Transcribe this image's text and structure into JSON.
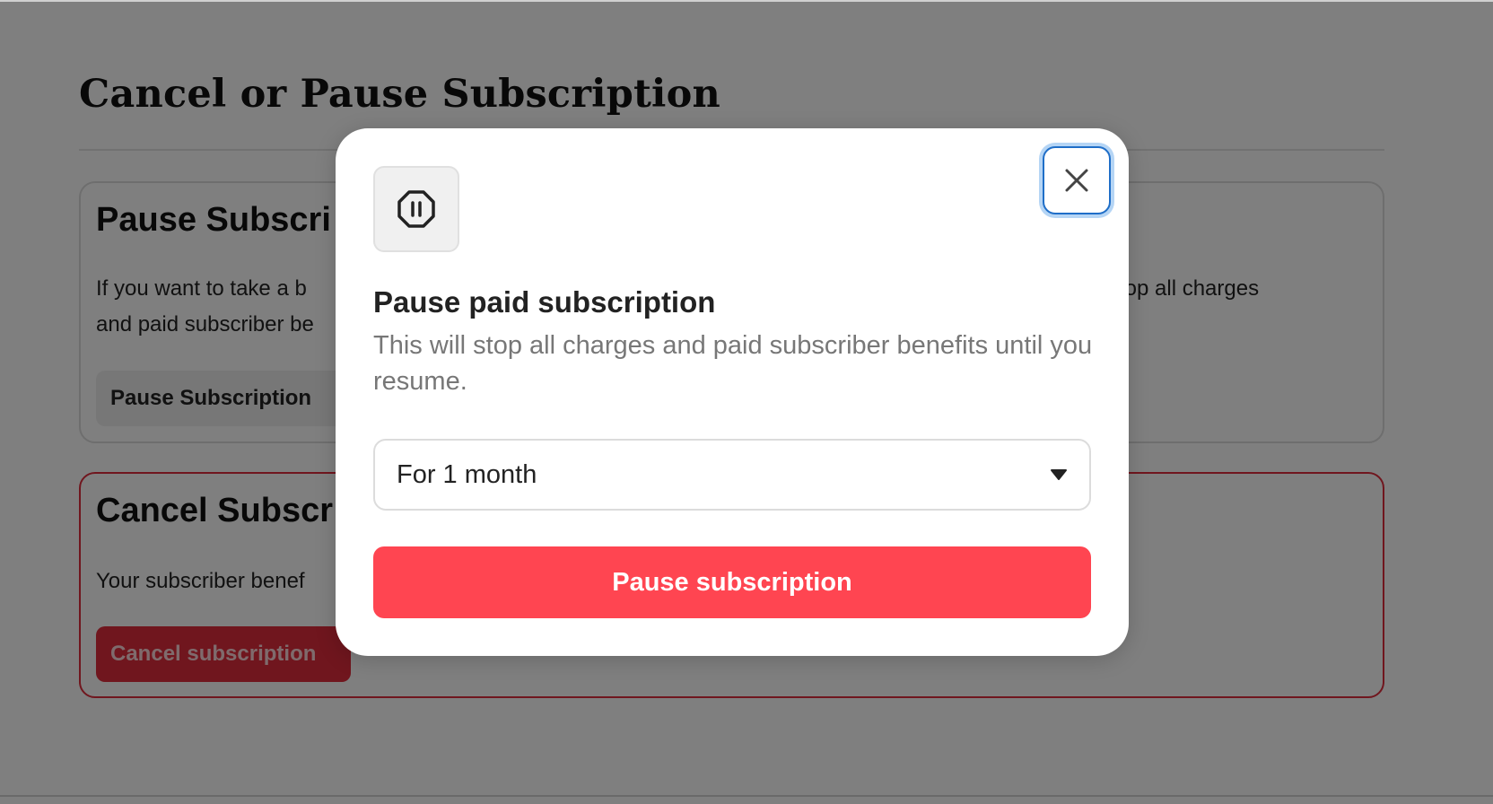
{
  "page": {
    "title": "Cancel or Pause Subscription"
  },
  "pause_card": {
    "title": "Pause Subscri",
    "text_line1_left": "If you want to take a b",
    "text_line1_right": "will stop all charges",
    "text_line2": "and paid subscriber be",
    "button_label": "Pause Subscription"
  },
  "cancel_card": {
    "title": "Cancel Subscr",
    "text": "Your subscriber benef",
    "button_label": "Cancel subscription"
  },
  "modal": {
    "icon": "pause-octagon-icon",
    "close_icon": "close-icon",
    "title": "Pause paid subscription",
    "description": "This will stop all charges and paid subscriber benefits until you resume.",
    "duration_select": {
      "selected": "For 1 month",
      "icon": "caret-down-icon"
    },
    "primary_button_label": "Pause subscription"
  },
  "colors": {
    "danger": "#e02d3c",
    "primary_button": "#ff4551",
    "focus_ring": "#1f6ec8"
  }
}
